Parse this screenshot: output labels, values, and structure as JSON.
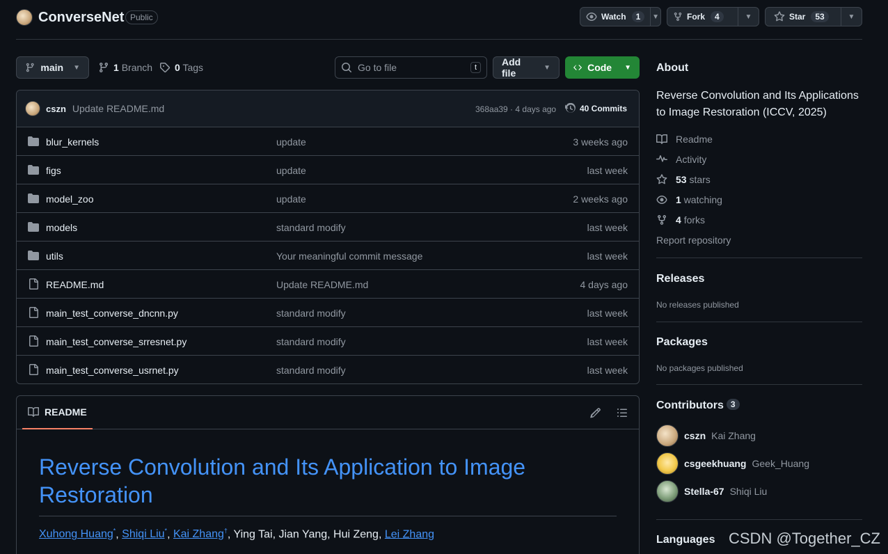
{
  "header": {
    "repo_name": "ConverseNet",
    "visibility": "Public",
    "watch_label": "Watch",
    "watch_count": "1",
    "fork_label": "Fork",
    "fork_count": "4",
    "star_label": "Star",
    "star_count": "53"
  },
  "toolbar": {
    "branch": "main",
    "branch_count": "1",
    "branch_label": "Branch",
    "tag_count": "0",
    "tag_label": "Tags",
    "goto_placeholder": "Go to file",
    "goto_shortcut": "t",
    "add_file_label": "Add file",
    "code_label": "Code"
  },
  "commit": {
    "author": "cszn",
    "message": "Update README.md",
    "meta": "368aa39 · 4 days ago",
    "commits": "40 Commits"
  },
  "files": [
    {
      "name": "blur_kernels",
      "type": "folder",
      "message": "update",
      "date": "3 weeks ago"
    },
    {
      "name": "figs",
      "type": "folder",
      "message": "update",
      "date": "last week"
    },
    {
      "name": "model_zoo",
      "type": "folder",
      "message": "update",
      "date": "2 weeks ago"
    },
    {
      "name": "models",
      "type": "folder",
      "message": "standard modify",
      "date": "last week"
    },
    {
      "name": "utils",
      "type": "folder",
      "message": "Your meaningful commit message",
      "date": "last week"
    },
    {
      "name": "README.md",
      "type": "file",
      "message": "Update README.md",
      "date": "4 days ago"
    },
    {
      "name": "main_test_converse_dncnn.py",
      "type": "file",
      "message": "standard modify",
      "date": "last week"
    },
    {
      "name": "main_test_converse_srresnet.py",
      "type": "file",
      "message": "standard modify",
      "date": "last week"
    },
    {
      "name": "main_test_converse_usrnet.py",
      "type": "file",
      "message": "standard modify",
      "date": "last week"
    }
  ],
  "readme": {
    "tab_label": "README",
    "title": "Reverse Convolution and Its Application to Image Restoration",
    "authors": [
      {
        "name": "Xuhong Huang",
        "mark": "*",
        "link": true
      },
      {
        "name": "Shiqi Liu",
        "mark": "*",
        "link": true
      },
      {
        "name": "Kai Zhang",
        "mark": "†",
        "link": true
      },
      {
        "name": "Ying Tai",
        "mark": "",
        "link": false
      },
      {
        "name": "Jian Yang",
        "mark": "",
        "link": false
      },
      {
        "name": "Hui Zeng",
        "mark": "",
        "link": false
      },
      {
        "name": "Lei Zhang",
        "mark": "",
        "link": true
      }
    ]
  },
  "about": {
    "title": "About",
    "description": "Reverse Convolution and Its Applications to Image Restoration (ICCV, 2025)",
    "readme": "Readme",
    "activity": "Activity",
    "stars_count": "53",
    "stars_label": "stars",
    "watching_count": "1",
    "watching_label": "watching",
    "forks_count": "4",
    "forks_label": "forks",
    "report": "Report repository"
  },
  "releases": {
    "title": "Releases",
    "sub": "No releases published"
  },
  "packages": {
    "title": "Packages",
    "sub": "No packages published"
  },
  "contributors": {
    "title": "Contributors",
    "count": "3",
    "people": [
      {
        "login": "cszn",
        "name": "Kai Zhang"
      },
      {
        "login": "csgeekhuang",
        "name": "Geek_Huang"
      },
      {
        "login": "Stella-67",
        "name": "Shiqi Liu"
      }
    ]
  },
  "languages": {
    "title": "Languages"
  },
  "watermark": "CSDN @Together_CZ",
  "colors": {
    "background": "#0d1117",
    "accent_link": "#4493f8",
    "code_button": "#238636",
    "tab_underline": "#f78166"
  }
}
